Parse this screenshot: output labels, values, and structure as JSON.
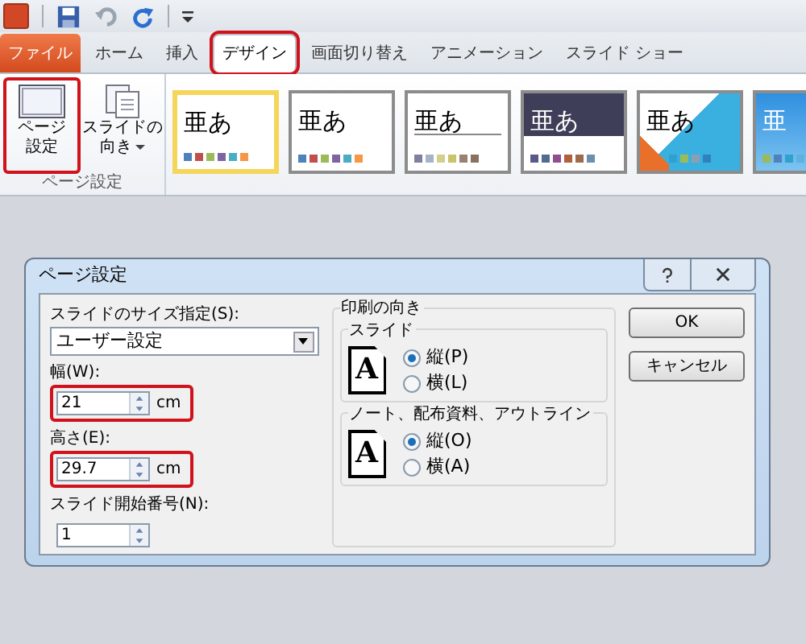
{
  "tabs": [
    {
      "label": "ファイル",
      "kind": "file",
      "selected": false,
      "highlighted": false
    },
    {
      "label": "ホーム",
      "kind": "tab",
      "selected": false,
      "highlighted": false
    },
    {
      "label": "挿入",
      "kind": "tab",
      "selected": false,
      "highlighted": false
    },
    {
      "label": "デザイン",
      "kind": "tab",
      "selected": true,
      "highlighted": true
    },
    {
      "label": "画面切り替え",
      "kind": "tab",
      "selected": false,
      "highlighted": false
    },
    {
      "label": "アニメーション",
      "kind": "tab",
      "selected": false,
      "highlighted": false
    },
    {
      "label": "スライド ショー",
      "kind": "tab",
      "selected": false,
      "highlighted": false
    }
  ],
  "ribbon": {
    "group_label": "ページ設定",
    "buttons": [
      {
        "lines": [
          "ページ",
          "設定"
        ],
        "kind": "page",
        "dropdown": false,
        "highlighted": true
      },
      {
        "lines": [
          "スライドの",
          "向き"
        ],
        "kind": "orientation",
        "dropdown": true,
        "highlighted": false
      }
    ],
    "themes": [
      {
        "sample": "亜あ",
        "kind": "plain",
        "selected": true
      },
      {
        "sample": "亜あ",
        "kind": "plain",
        "selected": false
      },
      {
        "sample": "亜あ",
        "kind": "boxed",
        "selected": false
      },
      {
        "sample": "亜あ",
        "kind": "dark",
        "selected": false
      },
      {
        "sample": "亜あ",
        "kind": "diagonal",
        "selected": false
      },
      {
        "sample": "亜",
        "kind": "blue",
        "selected": false
      }
    ]
  },
  "dialog": {
    "title": "ページ設定",
    "size": {
      "label": "スライドのサイズ指定(S):",
      "value": "ユーザー設定"
    },
    "fields": [
      {
        "label": "幅(W):",
        "value": "21",
        "unit": "cm",
        "highlighted": true
      },
      {
        "label": "高さ(E):",
        "value": "29.7",
        "unit": "cm",
        "highlighted": true
      },
      {
        "label": "スライド開始番号(N):",
        "value": "1",
        "highlighted": false
      }
    ],
    "orientation": {
      "label": "印刷の向き",
      "groups": [
        {
          "label": "スライド",
          "glyph": "A",
          "options": [
            {
              "label": "縦(P)",
              "selected": true
            },
            {
              "label": "横(L)",
              "selected": false
            }
          ]
        },
        {
          "label": "ノート、配布資料、アウトライン",
          "glyph": "A",
          "options": [
            {
              "label": "縦(O)",
              "selected": true
            },
            {
              "label": "横(A)",
              "selected": false
            }
          ]
        }
      ]
    },
    "buttons": [
      "OK",
      "キャンセル"
    ]
  }
}
